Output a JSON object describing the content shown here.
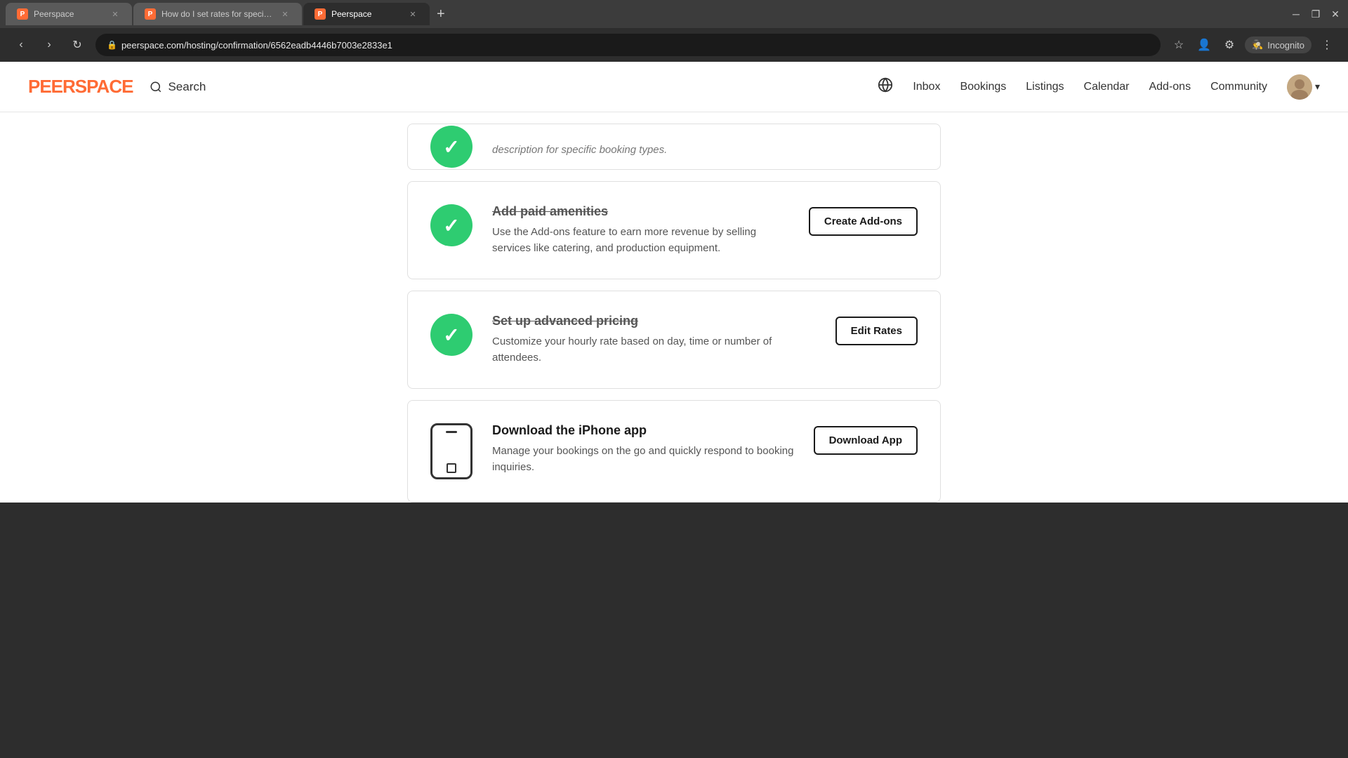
{
  "browser": {
    "tabs": [
      {
        "id": "tab1",
        "favicon": "P",
        "title": "Peerspace",
        "active": false
      },
      {
        "id": "tab2",
        "favicon": "P",
        "title": "How do I set rates for specific d...",
        "active": false
      },
      {
        "id": "tab3",
        "favicon": "P",
        "title": "Peerspace",
        "active": true
      }
    ],
    "new_tab_label": "+",
    "address": "peerspace.com/hosting/confirmation/6562eadb4446b7003e2833e1",
    "incognito_label": "Incognito"
  },
  "navbar": {
    "logo": "PEERSPACE",
    "search_label": "Search",
    "globe_label": "🌐",
    "links": [
      "Inbox",
      "Bookings",
      "Listings",
      "Calendar",
      "Add-ons",
      "Community"
    ],
    "chevron": "▾"
  },
  "partial_card": {
    "description": "description for specific booking types."
  },
  "cards": [
    {
      "id": "add-paid-amenities",
      "title": "Add paid amenities",
      "description": "Use the Add-ons feature to earn more revenue by selling services like catering, and production equipment.",
      "button_label": "Create Add-ons",
      "icon_type": "check"
    },
    {
      "id": "set-up-advanced-pricing",
      "title": "Set up advanced pricing",
      "description": "Customize your hourly rate based on day, time or number of attendees.",
      "button_label": "Edit Rates",
      "icon_type": "check"
    },
    {
      "id": "download-iphone-app",
      "title": "Download the iPhone app",
      "description": "Manage your bookings on the go and quickly respond to booking inquiries.",
      "button_label": "Download App",
      "icon_type": "phone"
    }
  ],
  "colors": {
    "green_check": "#2ecc71",
    "border": "#e0e0e0",
    "text_dark": "#1a1a1a",
    "text_muted": "#555"
  }
}
